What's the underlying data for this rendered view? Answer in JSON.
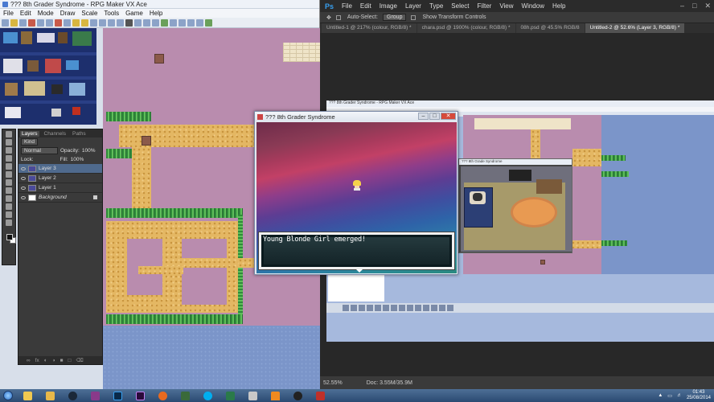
{
  "rpg_maker": {
    "title": "??? 8th Grader Syndrome - RPG Maker VX Ace",
    "menu": [
      "File",
      "Edit",
      "Mode",
      "Draw",
      "Scale",
      "Tools",
      "Game",
      "Help"
    ]
  },
  "photoshop": {
    "logo": "Ps",
    "menu": [
      "File",
      "Edit",
      "Image",
      "Layer",
      "Type",
      "Select",
      "Filter",
      "View",
      "Window",
      "Help"
    ],
    "options": {
      "auto_select_label": "Auto-Select:",
      "auto_select_value": "Group",
      "transform_label": "Show Transform Controls"
    },
    "tabs": [
      "Untitled-1 @ 217% (colour, RGB/8) *",
      "chara.psd @ 1900% (colour, RGB/8) *",
      "08h.psd @ 45.5% RGB/8",
      "Untitled-2 @ 52.6% (Layer 3, RGB/8) *"
    ],
    "active_tab_index": 3,
    "status": {
      "zoom": "52.55%",
      "doc": "Doc: 3.55M/35.9M"
    },
    "window_controls": [
      "–",
      "□",
      "✕"
    ]
  },
  "layers_panel": {
    "tabs": [
      "Layers",
      "Channels",
      "Paths"
    ],
    "kind_label": "Kind",
    "blend_mode": "Normal",
    "opacity_label": "Opacity:",
    "opacity_value": "100%",
    "lock_label": "Lock:",
    "fill_label": "Fill:",
    "fill_value": "100%",
    "layers": [
      {
        "name": "Layer 3",
        "selected": true
      },
      {
        "name": "Layer 2",
        "selected": false
      },
      {
        "name": "Layer 1",
        "selected": false
      },
      {
        "name": "Background",
        "selected": false,
        "locked": true
      }
    ]
  },
  "game_window": {
    "title": "??? 8th Grader Syndrome",
    "dialog_text": "Young Blonde Girl emerged!"
  },
  "embedded_screenshot": {
    "title": "??? 8th Grader Syndrome - RPG Maker VX Ace",
    "game_title": "??? 8th Grade Syndrome"
  },
  "taskbar": {
    "apps": [
      "explorer",
      "folder",
      "steam",
      "winrar",
      "photoshop",
      "premiere",
      "firefox",
      "game",
      "skype",
      "rpgmaker",
      "network",
      "vlc",
      "obs",
      "fox"
    ],
    "clock_time": "01:43",
    "clock_date": "25/08/2014"
  },
  "colors": {
    "map_bg": "#b98cae",
    "path": "#e4b763",
    "grass": "#2f8a3a",
    "water": "#7b95c9",
    "ps_dark": "#323232",
    "ps_accent": "#38a0f0"
  }
}
